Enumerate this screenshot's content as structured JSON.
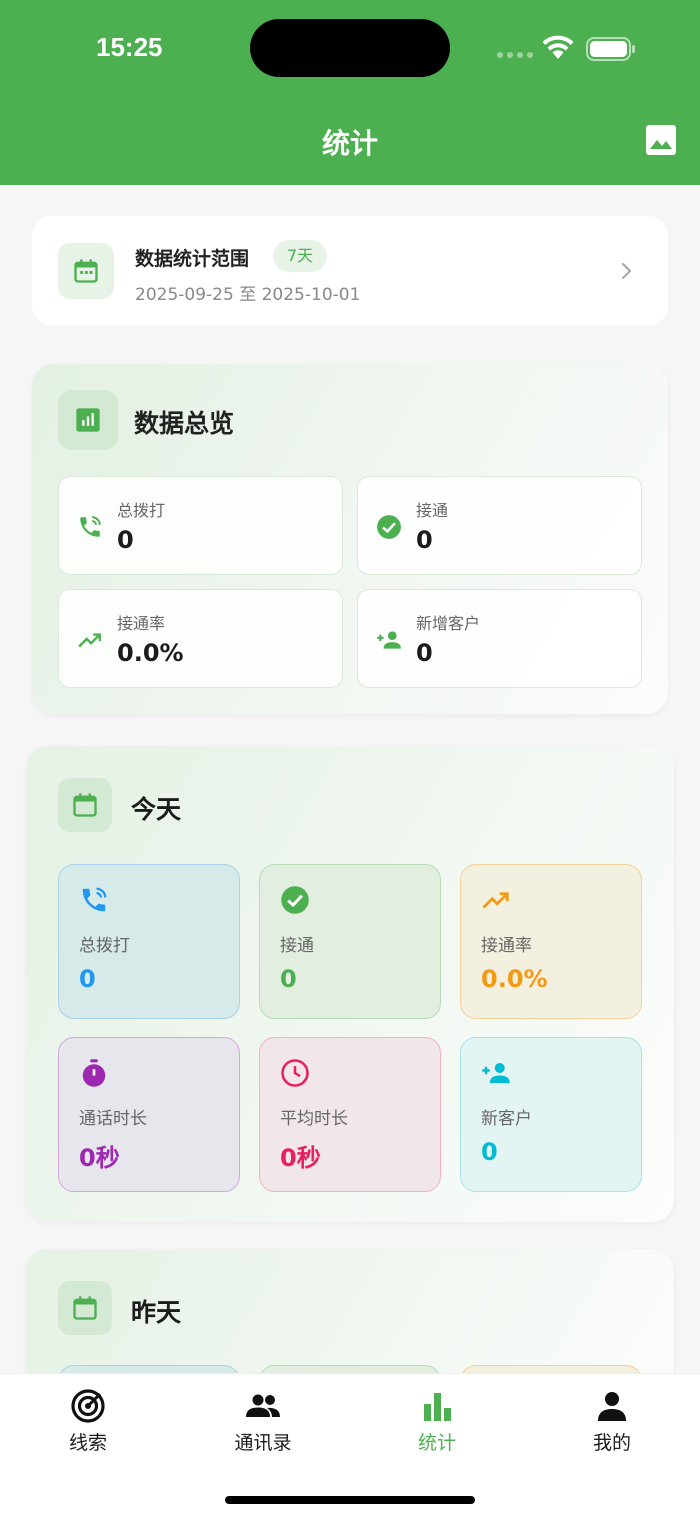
{
  "status": {
    "time": "15:25"
  },
  "header": {
    "title": "统计",
    "image_icon": "image-icon"
  },
  "range": {
    "title": "数据统计范围",
    "badge": "7天",
    "dates": "2025-09-25 至 2025-10-01",
    "icon": "calendar-icon"
  },
  "overview": {
    "title": "数据总览",
    "icon": "bar-chart-icon",
    "tiles": [
      {
        "label": "总拨打",
        "value": "0",
        "icon": "phone-call-icon"
      },
      {
        "label": "接通",
        "value": "0",
        "icon": "check-circle-icon"
      },
      {
        "label": "接通率",
        "value": "0.0%",
        "icon": "trending-up-icon"
      },
      {
        "label": "新增客户",
        "value": "0",
        "icon": "person-add-icon"
      }
    ]
  },
  "today": {
    "title": "今天",
    "icon": "calendar-icon",
    "stats": [
      {
        "label": "总拨打",
        "value": "0",
        "icon": "phone-call-icon",
        "color": "#2196f3"
      },
      {
        "label": "接通",
        "value": "0",
        "icon": "check-circle-icon",
        "color": "#4caf50"
      },
      {
        "label": "接通率",
        "value": "0.0%",
        "icon": "trending-up-icon",
        "color": "#f29a16"
      },
      {
        "label": "通话时长",
        "value": "0秒",
        "icon": "timer-icon",
        "color": "#9c27b0"
      },
      {
        "label": "平均时长",
        "value": "0秒",
        "icon": "clock-icon",
        "color": "#e91e63"
      },
      {
        "label": "新客户",
        "value": "0",
        "icon": "person-add-icon",
        "color": "#00bcd4"
      }
    ]
  },
  "yesterday": {
    "title": "昨天",
    "icon": "calendar-icon"
  },
  "tabs": [
    {
      "label": "线索",
      "icon": "target-icon",
      "active": false
    },
    {
      "label": "通讯录",
      "icon": "people-icon",
      "active": false
    },
    {
      "label": "统计",
      "icon": "bar-chart-icon",
      "active": true
    },
    {
      "label": "我的",
      "icon": "person-icon",
      "active": false
    }
  ],
  "colors": {
    "primary": "#4caf50"
  }
}
